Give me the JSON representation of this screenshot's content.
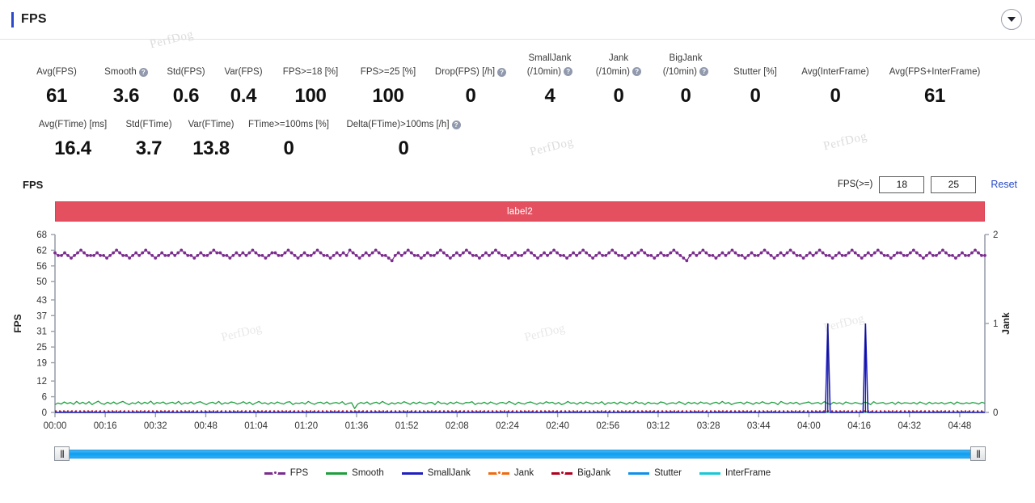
{
  "header": {
    "title": "FPS",
    "collapse_icon": "chevron-down-icon",
    "accent_color": "#2b4acb"
  },
  "stats": {
    "row1": [
      {
        "label": "Avg(FPS)",
        "value": "61",
        "help": false
      },
      {
        "label": "Smooth",
        "value": "3.6",
        "help": true
      },
      {
        "label": "Std(FPS)",
        "value": "0.6",
        "help": false
      },
      {
        "label": "Var(FPS)",
        "value": "0.4",
        "help": false
      },
      {
        "label": "FPS>=18 [%]",
        "value": "100",
        "help": false
      },
      {
        "label": "FPS>=25 [%]",
        "value": "100",
        "help": false
      },
      {
        "label": "Drop(FPS) [/h]",
        "value": "0",
        "help": true
      },
      {
        "label": "SmallJank",
        "label2": "(/10min)",
        "value": "4",
        "help": true
      },
      {
        "label": "Jank",
        "label2": "(/10min)",
        "value": "0",
        "help": true
      },
      {
        "label": "BigJank",
        "label2": "(/10min)",
        "value": "0",
        "help": true
      },
      {
        "label": "Stutter [%]",
        "value": "0",
        "help": false
      },
      {
        "label": "Avg(InterFrame)",
        "value": "0",
        "help": false
      },
      {
        "label": "Avg(FPS+InterFrame)",
        "value": "61",
        "help": false
      }
    ],
    "row2": [
      {
        "label": "Avg(FTime) [ms]",
        "value": "16.4",
        "help": false
      },
      {
        "label": "Std(FTime)",
        "value": "3.7",
        "help": false
      },
      {
        "label": "Var(FTime)",
        "value": "13.8",
        "help": false
      },
      {
        "label": "FTime>=100ms [%]",
        "value": "0",
        "help": false
      },
      {
        "label": "Delta(FTime)>100ms [/h]",
        "value": "0",
        "help": true
      }
    ]
  },
  "chart_header": {
    "title": "FPS",
    "filter_label": "FPS(>=)",
    "threshold_low": "18",
    "threshold_high": "25",
    "threshold_low_placeholder": "18",
    "threshold_high_placeholder": "25",
    "reset_label": "Reset"
  },
  "label_bar": {
    "text": "label2",
    "color": "#e4505f"
  },
  "range_slider": {
    "left_handle": "drag-handle-icon",
    "right_handle": "drag-handle-icon",
    "track_color": "#0d9ef0"
  },
  "watermark": {
    "text": "PerfDog"
  },
  "legend": [
    {
      "label": "FPS",
      "color": "#7b2d8e",
      "marker": true
    },
    {
      "label": "Smooth",
      "color": "#1f9e3f",
      "marker": false
    },
    {
      "label": "SmallJank",
      "color": "#2020c0",
      "marker": false
    },
    {
      "label": "Jank",
      "color": "#f06a10",
      "marker": true
    },
    {
      "label": "BigJank",
      "color": "#b00020",
      "marker": true
    },
    {
      "label": "Stutter",
      "color": "#1090e8",
      "marker": false
    },
    {
      "label": "InterFrame",
      "color": "#18c8d8",
      "marker": false
    }
  ],
  "chart_data": {
    "type": "line",
    "title": "FPS",
    "xlabel": "",
    "ylabel": "FPS",
    "y2label": "Jank",
    "grid": false,
    "legend_position": "bottom",
    "x_tick_labels": [
      "00:00",
      "00:16",
      "00:32",
      "00:48",
      "01:04",
      "01:20",
      "01:36",
      "01:52",
      "02:08",
      "02:24",
      "02:40",
      "02:56",
      "03:12",
      "03:28",
      "03:44",
      "04:00",
      "04:16",
      "04:32",
      "04:48"
    ],
    "x_tick_seconds": [
      0,
      16,
      32,
      48,
      64,
      80,
      96,
      112,
      128,
      144,
      160,
      176,
      192,
      208,
      224,
      240,
      256,
      272,
      288
    ],
    "y_tick_labels": [
      "0",
      "6",
      "12",
      "19",
      "25",
      "31",
      "37",
      "43",
      "50",
      "56",
      "62",
      "68"
    ],
    "y_tick_values": [
      0,
      6,
      12,
      19,
      25,
      31,
      37,
      43,
      50,
      56,
      62,
      68
    ],
    "ylim": [
      0,
      68
    ],
    "y2_tick_labels": [
      "0",
      "1",
      "2"
    ],
    "y2_tick_values": [
      0,
      1,
      2
    ],
    "y2lim": [
      0,
      2
    ],
    "xlim_seconds": [
      0,
      296
    ],
    "series": [
      {
        "name": "FPS",
        "color": "#7b2d8e",
        "axis": "left",
        "marker": true,
        "values": [
          61,
          60,
          60,
          61,
          60,
          59,
          60,
          61,
          62,
          61,
          60,
          60,
          60,
          61,
          60,
          60,
          59,
          60,
          61,
          62,
          61,
          60,
          60,
          59,
          60,
          61,
          60,
          61,
          62,
          61,
          60,
          59,
          60,
          61,
          60,
          60,
          61,
          60,
          61,
          62,
          61,
          60,
          60,
          59,
          60,
          61,
          60,
          60,
          61,
          62,
          61,
          61,
          60,
          60,
          59,
          60,
          61,
          60,
          61,
          60,
          61,
          62,
          61,
          60,
          60,
          59,
          60,
          61,
          61,
          60,
          60,
          61,
          62,
          61,
          60,
          59,
          60,
          61,
          60,
          60,
          61,
          62,
          61,
          60,
          60,
          59,
          60,
          61,
          60,
          61,
          60,
          62,
          61,
          60,
          59,
          60,
          61,
          60,
          61,
          62,
          61,
          60,
          60,
          59,
          58,
          60,
          61,
          60,
          61,
          62,
          61,
          60,
          60,
          59,
          60,
          61,
          60,
          60,
          61,
          62,
          61,
          60,
          59,
          60,
          61,
          60,
          61,
          62,
          61,
          60,
          60,
          59,
          60,
          61,
          60,
          61,
          62,
          61,
          60,
          60,
          59,
          60,
          61,
          60,
          60,
          61,
          62,
          61,
          60,
          59,
          60,
          61,
          60,
          61,
          62,
          61,
          60,
          60,
          59,
          60,
          61,
          60,
          61,
          62,
          61,
          60,
          59,
          60,
          61,
          60,
          60,
          61,
          62,
          61,
          60,
          60,
          59,
          60,
          61,
          60,
          61,
          62,
          61,
          60,
          60,
          59,
          60,
          61,
          60,
          60,
          61,
          62,
          61,
          60,
          59,
          58,
          60,
          61,
          60,
          61,
          62,
          61,
          60,
          60,
          59,
          60,
          61,
          60,
          61,
          62,
          61,
          60,
          60,
          59,
          60,
          61,
          60,
          60,
          61,
          62,
          61,
          60,
          59,
          60,
          61,
          60,
          61,
          62,
          61,
          60,
          60,
          59,
          60,
          61,
          60,
          61,
          62,
          61,
          60,
          60,
          59,
          60,
          61,
          60,
          60,
          61,
          62,
          61,
          60,
          59,
          60,
          61,
          60,
          61,
          62,
          61,
          60,
          60,
          59,
          60,
          61,
          61,
          60,
          60,
          61,
          62,
          61,
          60,
          59,
          60,
          61,
          60,
          60,
          61,
          62,
          61,
          60,
          60,
          59,
          60,
          61,
          60,
          60,
          61,
          62,
          61,
          60,
          60
        ]
      },
      {
        "name": "Smooth",
        "color": "#1f9e3f",
        "axis": "left",
        "marker": false,
        "values": [
          3.0,
          3.6,
          3.2,
          4.0,
          3.4,
          3.8,
          3.1,
          4.2,
          3.3,
          3.9,
          3.2,
          4.1,
          3.0,
          3.7,
          4.3,
          3.4,
          3.1,
          3.9,
          3.3,
          4.0,
          3.2,
          3.8,
          4.2,
          3.5,
          3.0,
          3.7,
          3.3,
          4.1,
          3.2,
          3.9,
          3.4,
          4.3,
          3.1,
          3.8,
          3.5,
          4.0,
          3.2,
          3.6,
          3.9,
          3.3,
          4.2,
          3.1,
          3.7,
          3.4,
          4.0,
          3.2,
          3.8,
          4.1,
          3.5,
          3.0,
          3.6,
          3.9,
          3.3,
          4.2,
          3.1,
          3.7,
          3.4,
          4.0,
          3.8,
          3.2,
          3.5,
          4.1,
          3.3,
          3.9,
          3.0,
          3.6,
          4.2,
          3.4,
          3.7,
          3.1,
          3.8,
          3.3,
          4.0,
          3.5,
          3.2,
          3.9,
          4.1,
          3.0,
          3.6,
          3.4,
          3.8,
          3.2,
          4.2,
          3.5,
          3.1,
          3.7,
          3.9,
          3.3,
          4.0,
          3.2,
          3.6,
          3.8,
          3.4,
          4.1,
          3.0,
          3.5,
          3.7,
          1.5,
          3.2,
          3.8,
          3.4,
          4.0,
          3.1,
          3.6,
          3.9,
          3.3,
          4.2,
          3.5,
          3.0,
          3.7,
          3.2,
          3.8,
          3.4,
          4.1,
          3.6,
          3.1,
          3.9,
          3.3,
          4.0,
          3.5,
          3.2,
          3.7,
          3.8,
          3.0,
          4.2,
          3.4,
          3.6,
          3.1,
          3.9,
          3.3,
          4.0,
          3.5,
          3.2,
          3.8,
          3.7,
          4.1,
          3.0,
          3.6,
          3.4,
          3.9,
          3.2,
          4.0,
          3.5,
          3.1,
          3.7,
          3.8,
          3.3,
          4.2,
          3.6,
          3.0,
          3.9,
          3.4,
          3.2,
          3.8,
          4.0,
          3.5,
          3.1,
          3.7,
          3.3,
          4.1,
          3.6,
          3.9,
          3.2,
          3.8,
          3.0,
          3.4,
          4.2,
          3.5,
          3.7,
          3.1,
          3.9,
          3.3,
          4.0,
          3.6,
          3.2,
          3.8,
          3.4,
          4.1,
          3.0,
          3.7,
          3.5,
          3.9,
          3.2,
          4.0,
          3.6,
          3.1,
          3.8,
          3.3,
          4.2,
          3.5,
          3.7,
          3.0,
          3.9,
          3.4,
          3.6,
          3.2,
          4.0,
          3.8,
          3.1,
          3.5,
          3.7,
          3.3,
          4.1,
          3.6,
          3.0,
          3.9,
          3.4,
          3.8,
          3.2,
          4.0,
          3.5,
          3.7,
          3.1,
          3.6,
          3.9,
          3.3,
          4.2,
          3.4,
          3.8,
          3.0,
          3.5,
          3.7,
          3.9,
          3.2,
          4.0,
          3.6,
          3.1,
          3.8,
          3.4,
          4.1,
          3.5,
          3.3,
          3.9,
          3.7,
          3.0,
          4.2,
          3.6,
          3.2,
          3.8,
          3.4,
          3.9,
          3.1,
          3.5,
          3.7,
          4.0,
          3.3,
          3.6,
          3.8,
          3.2,
          4.1,
          3.5,
          3.0,
          3.9,
          3.4,
          3.7,
          3.1,
          4.0,
          3.6,
          3.3,
          3.8,
          3.5,
          3.2,
          3.9,
          3.7,
          3.0,
          4.1,
          3.4,
          3.6,
          3.8,
          3.2,
          3.5,
          3.9,
          3.1,
          4.0,
          3.3,
          3.7,
          3.6,
          3.4,
          3.8,
          3.2,
          4.0,
          3.5,
          3.1,
          3.9,
          3.3,
          3.7,
          3.4,
          3.8,
          3.2,
          3.6,
          3.9,
          3.1,
          4.0,
          3.5,
          3.3,
          3.7,
          3.4,
          3.8,
          3.6,
          3.2,
          3.9,
          3.5
        ]
      },
      {
        "name": "SmallJank",
        "color": "#2020c0",
        "axis": "right",
        "marker": false,
        "spikes_at_seconds": [
          246,
          258
        ],
        "spike_value": 1
      },
      {
        "name": "Jank",
        "color": "#f06a10",
        "axis": "right",
        "marker": true,
        "constant": 0
      },
      {
        "name": "BigJank",
        "color": "#b00020",
        "axis": "right",
        "marker": true,
        "constant": 0
      },
      {
        "name": "Stutter",
        "color": "#1090e8",
        "axis": "left",
        "marker": false,
        "constant": 0
      },
      {
        "name": "InterFrame",
        "color": "#18c8d8",
        "axis": "left",
        "marker": false,
        "constant": 0
      }
    ]
  }
}
